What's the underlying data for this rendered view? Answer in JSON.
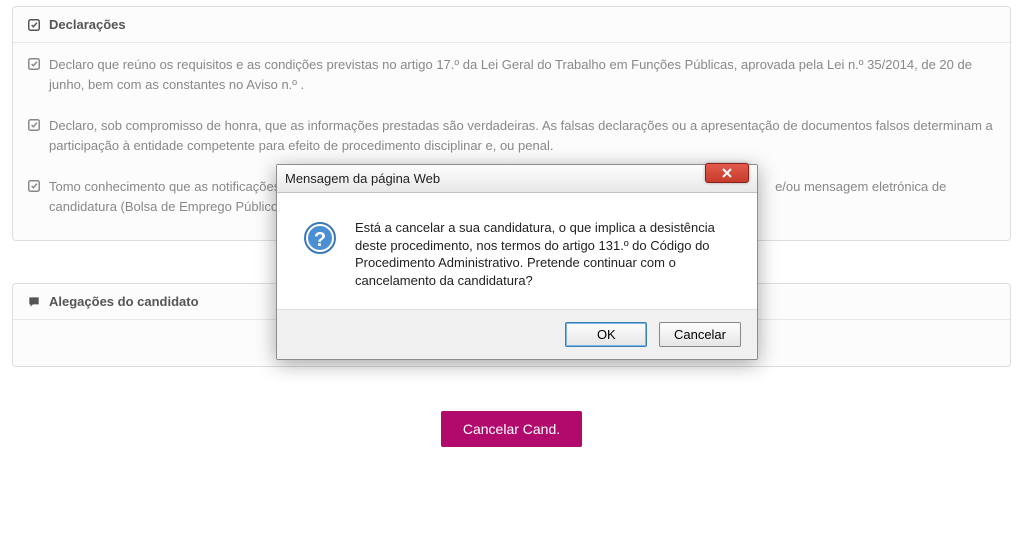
{
  "panel_decl": {
    "title": "Declarações",
    "items": [
      "Declaro que reúno os requisitos e as condições previstas no artigo 17.º da Lei Geral do Trabalho em Funções Públicas, aprovada pela Lei n.º 35/2014, de 20 de junho, bem com as constantes no Aviso n.º .",
      "Declaro, sob compromisso de honra, que as informações prestadas são verdadeiras. As falsas declarações ou a apresentação de documentos falsos determinam a participação à entidade competente para efeito de procedimento disciplinar e, ou penal.",
      "Tomo conhecimento que as notificações                                                                                                                                         e/ou mensagem eletrónica de candidatura (Bolsa de Emprego Público - BE"
    ]
  },
  "panel_aleg": {
    "title": "Alegações do candidato"
  },
  "main_button": "Cancelar Cand.",
  "dialog": {
    "title": "Mensagem da página Web",
    "message": "Está a cancelar a sua candidatura, o que implica a desistência deste procedimento, nos termos do artigo 131.º do Código do Procedimento Administrativo. Pretende continuar com o cancelamento da candidatura?",
    "ok": "OK",
    "cancel": "Cancelar"
  }
}
